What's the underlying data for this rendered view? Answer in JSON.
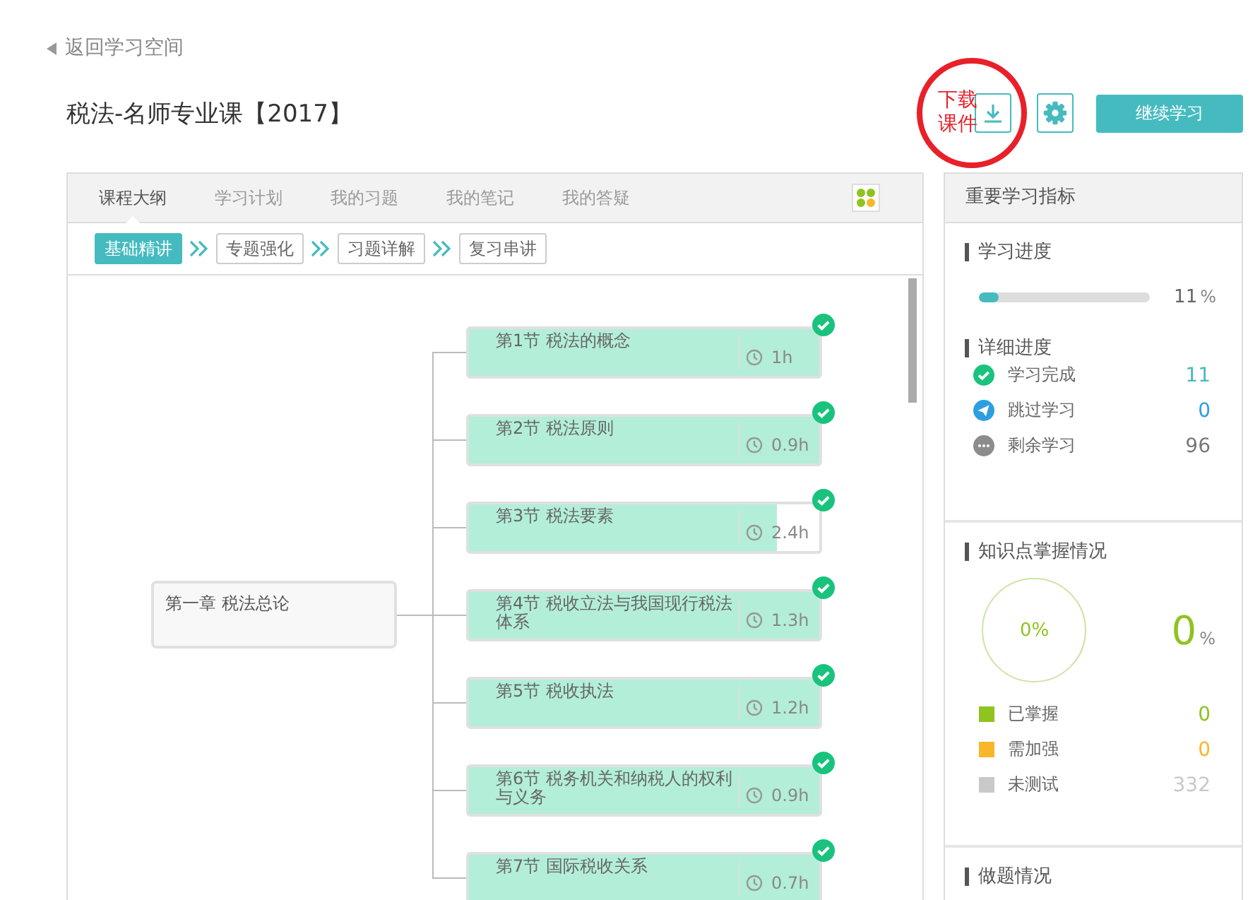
{
  "back_link": {
    "text": "返回学习空间"
  },
  "course_title": "税法-名师专业课【2017】",
  "annotation": {
    "lines": [
      "下载",
      "课件"
    ]
  },
  "continue_button": "继续学习",
  "tabs": [
    {
      "label": "课程大纲",
      "selected": true
    },
    {
      "label": "学习计划",
      "selected": false
    },
    {
      "label": "我的习题",
      "selected": false
    },
    {
      "label": "我的笔记",
      "selected": false
    },
    {
      "label": "我的答疑",
      "selected": false
    }
  ],
  "stages": [
    {
      "label": "基础精讲",
      "selected": true
    },
    {
      "label": "专题强化",
      "selected": false
    },
    {
      "label": "习题详解",
      "selected": false
    },
    {
      "label": "复习串讲",
      "selected": false
    }
  ],
  "outline": {
    "chapter": "第一章 税法总论",
    "sections": [
      {
        "title": "第1节 税法的概念",
        "duration": "1h",
        "level": 1,
        "completed": true
      },
      {
        "title": "第2节 税法原则",
        "duration": "0.9h",
        "level": 1,
        "completed": true
      },
      {
        "title": "第3节 税法要素",
        "duration": "2.4h",
        "level": 0.88,
        "completed": true
      },
      {
        "title": "第4节 税收立法与我国现行税法体系",
        "duration": "1.3h",
        "level": 1,
        "completed": true
      },
      {
        "title": "第5节 税收执法",
        "duration": "1.2h",
        "level": 1,
        "completed": true
      },
      {
        "title": "第6节 税务机关和纳税人的权利与义务",
        "duration": "0.9h",
        "level": 1,
        "completed": true
      },
      {
        "title": "第7节 国际税收关系",
        "duration": "0.7h",
        "level": 1,
        "completed": true
      }
    ]
  },
  "metrics": {
    "title": "重要学习指标",
    "progress": {
      "heading": "学习进度",
      "level": 0.11,
      "value": "11",
      "unit": "%"
    },
    "detail": {
      "heading": "详细进度",
      "items": [
        {
          "kind": "done",
          "label": "学习完成",
          "count": "11",
          "color": "#19c37d"
        },
        {
          "kind": "skipped",
          "label": "跳过学习",
          "count": "0",
          "color": "#2d9fe0"
        },
        {
          "kind": "remaining",
          "label": "剩余学习",
          "count": "96",
          "color": "#8c8c8c"
        }
      ]
    },
    "mastery": {
      "heading": "知识点掌握情况",
      "donut_label": "0%",
      "value": "0",
      "unit": "%",
      "items": [
        {
          "label": "已掌握",
          "count": "0",
          "color": "#8fc31f"
        },
        {
          "label": "需加强",
          "count": "0",
          "color": "#f8b62b"
        },
        {
          "label": "未测试",
          "count": "332",
          "color": "#c9c9c9"
        }
      ]
    },
    "exercise": {
      "heading": "做题情况"
    }
  }
}
